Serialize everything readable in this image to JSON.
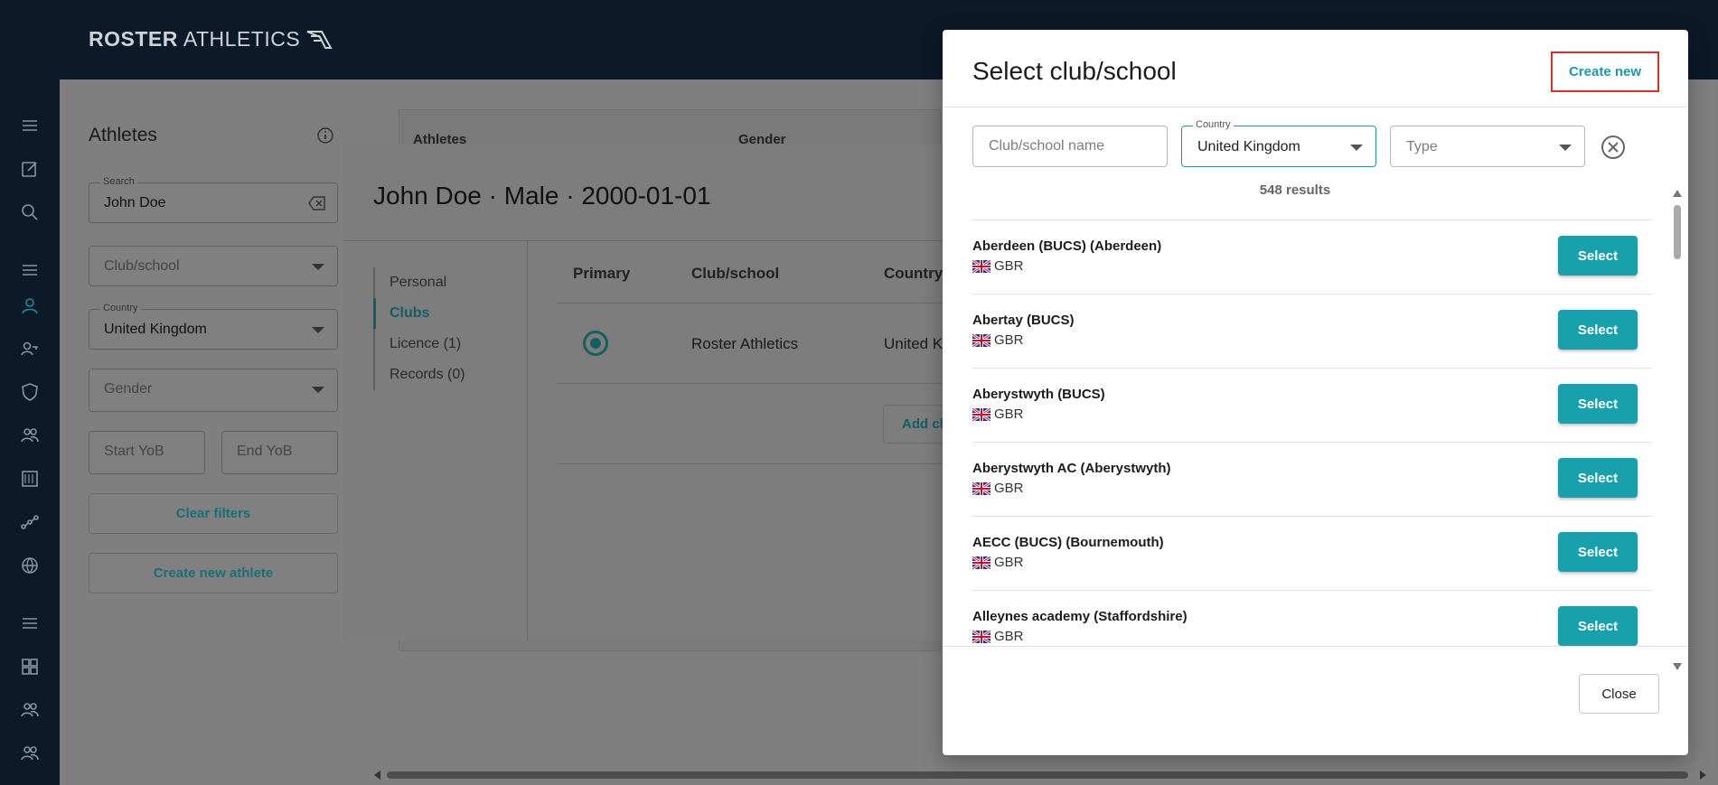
{
  "app": {
    "logo_bold": "ROSTER",
    "logo_light": "ATHLETICS"
  },
  "sidebar": {
    "icons": [
      "menu-icon",
      "edit-icon",
      "search-icon",
      "menu-icon",
      "person-icon",
      "user-key-icon",
      "shield-icon",
      "group-icon",
      "calendar-icon",
      "route-icon",
      "globe-icon",
      "menu-icon",
      "grid-icon",
      "group-icon",
      "group-icon"
    ]
  },
  "filters": {
    "title": "Athletes",
    "search_label": "Search",
    "search_value": "John Doe",
    "club_placeholder": "Club/school",
    "country_label": "Country",
    "country_value": "United Kingdom",
    "gender_placeholder": "Gender",
    "start_yob_placeholder": "Start YoB",
    "end_yob_placeholder": "End YoB",
    "clear_filters": "Clear filters",
    "create_athlete": "Create new athlete"
  },
  "athletes_table": {
    "col_athletes": "Athletes",
    "col_gender": "Gender"
  },
  "athlete_dialog": {
    "title": "John Doe · Male · 2000-01-01",
    "nav": [
      {
        "label": "Personal",
        "active": false
      },
      {
        "label": "Clubs",
        "active": true
      },
      {
        "label": "Licence (1)",
        "active": false
      },
      {
        "label": "Records (0)",
        "active": false
      }
    ],
    "columns": {
      "primary": "Primary",
      "club": "Club/school",
      "country": "Country"
    },
    "row": {
      "club": "Roster Athletics",
      "country": "United Ki"
    },
    "add_club": "Add cl"
  },
  "modal": {
    "title": "Select club/school",
    "create_new": "Create new",
    "name_placeholder": "Club/school name",
    "country_label": "Country",
    "country_value": "United Kingdom",
    "type_placeholder": "Type",
    "results": "548 results",
    "select_label": "Select",
    "close": "Close",
    "clubs": [
      {
        "name": "Aberdeen (BUCS) (Aberdeen)",
        "code": "GBR"
      },
      {
        "name": "Abertay (BUCS)",
        "code": "GBR"
      },
      {
        "name": "Aberystwyth (BUCS)",
        "code": "GBR"
      },
      {
        "name": "Aberystwyth AC (Aberystwyth)",
        "code": "GBR"
      },
      {
        "name": "AECC (BUCS) (Bournemouth)",
        "code": "GBR"
      },
      {
        "name": "Alleynes academy (Staffordshire)",
        "code": "GBR"
      }
    ]
  },
  "colors": {
    "accent": "#18a0ac",
    "topbar": "#0c1929",
    "highlight": "#d62f2f"
  }
}
